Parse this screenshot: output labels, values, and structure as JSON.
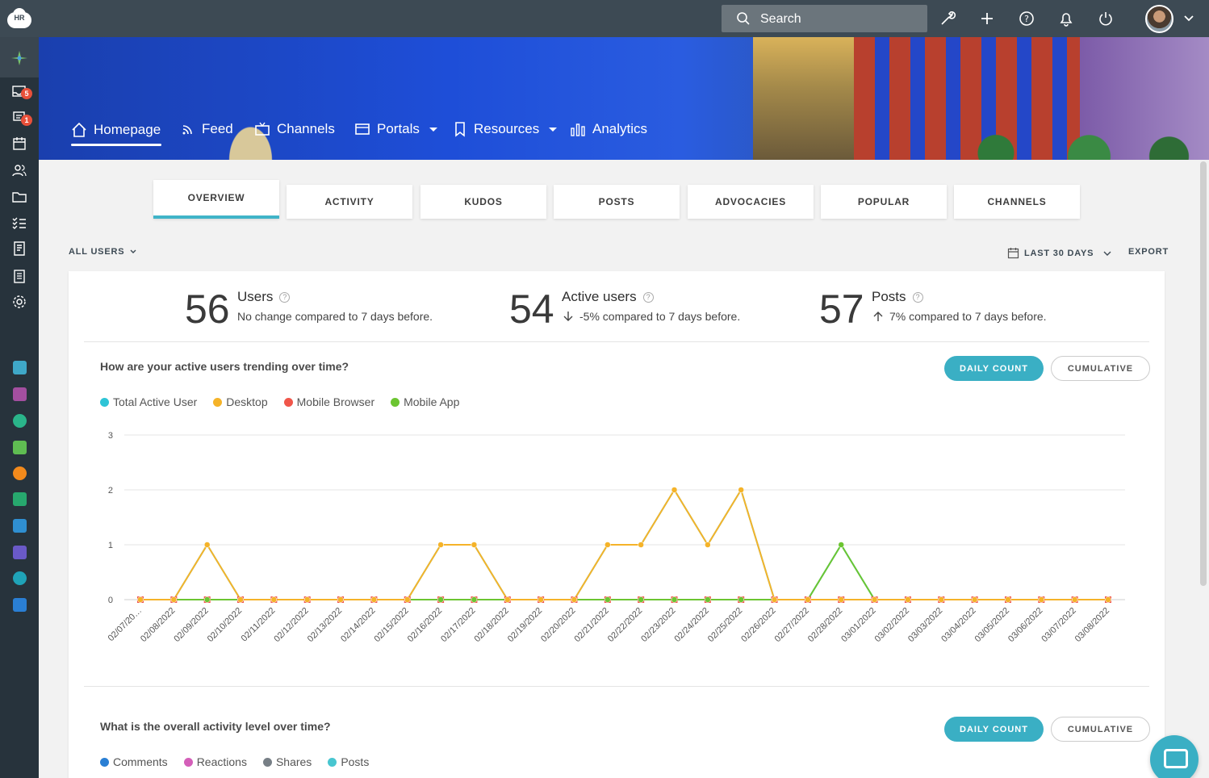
{
  "topbar": {
    "logo_text": "HR",
    "search_placeholder": "Search",
    "icons": [
      "wrench-icon",
      "plus-icon",
      "help-icon",
      "bell-icon",
      "power-icon"
    ]
  },
  "sidebar": {
    "badges": {
      "inbox": "5",
      "messages": "1"
    },
    "icons": [
      "hub-icon",
      "inbox-icon",
      "messages-icon",
      "calendar-icon",
      "people-icon",
      "folder-icon",
      "checklist-icon",
      "document-icon",
      "clipboard-icon",
      "settings-icon"
    ],
    "apps": [
      "app-1",
      "app-2",
      "app-3",
      "app-4",
      "app-5",
      "app-6",
      "app-7",
      "app-8",
      "app-9",
      "app-10"
    ]
  },
  "nav": {
    "items": [
      {
        "label": "Homepage",
        "icon": "home-icon"
      },
      {
        "label": "Feed",
        "icon": "feed-icon"
      },
      {
        "label": "Channels",
        "icon": "channels-icon"
      },
      {
        "label": "Portals",
        "icon": "portals-icon"
      },
      {
        "label": "Resources",
        "icon": "bookmark-icon"
      },
      {
        "label": "Analytics",
        "icon": "analytics-icon"
      }
    ]
  },
  "tabs": [
    "OVERVIEW",
    "ACTIVITY",
    "KUDOS",
    "POSTS",
    "ADVOCACIES",
    "POPULAR",
    "CHANNELS"
  ],
  "filters": {
    "users": "ALL USERS",
    "range": "LAST 30 DAYS",
    "export": "EXPORT"
  },
  "stats": [
    {
      "value": "56",
      "title": "Users",
      "sub": "No change compared to 7 days before.",
      "trend": ""
    },
    {
      "value": "54",
      "title": "Active users",
      "sub": "-5% compared to 7 days before.",
      "trend": "down"
    },
    {
      "value": "57",
      "title": "Posts",
      "sub": "7% compared to 7 days before.",
      "trend": "up"
    }
  ],
  "section1": {
    "title": "How are your active users trending over time?",
    "daily": "DAILY COUNT",
    "cumulative": "CUMULATIVE",
    "legend": [
      {
        "name": "Total Active User",
        "color": "#2ec4d6"
      },
      {
        "name": "Desktop",
        "color": "#f5b329"
      },
      {
        "name": "Mobile Browser",
        "color": "#f0564a"
      },
      {
        "name": "Mobile App",
        "color": "#6cc531"
      }
    ]
  },
  "section2": {
    "title": "What is the overall activity level over time?",
    "daily": "DAILY COUNT",
    "cumulative": "CUMULATIVE",
    "legend": [
      {
        "name": "Comments",
        "color": "#2a7fd4"
      },
      {
        "name": "Reactions",
        "color": "#d45fb9"
      },
      {
        "name": "Shares",
        "color": "#777f86"
      },
      {
        "name": "Posts",
        "color": "#48c6d0"
      }
    ]
  },
  "chart_data": {
    "type": "line",
    "title": "How are your active users trending over time?",
    "x": [
      "02/07/20…",
      "02/08/2022",
      "02/09/2022",
      "02/10/2022",
      "02/11/2022",
      "02/12/2022",
      "02/13/2022",
      "02/14/2022",
      "02/15/2022",
      "02/16/2022",
      "02/17/2022",
      "02/18/2022",
      "02/19/2022",
      "02/20/2022",
      "02/21/2022",
      "02/22/2022",
      "02/23/2022",
      "02/24/2022",
      "02/25/2022",
      "02/26/2022",
      "02/27/2022",
      "02/28/2022",
      "03/01/2022",
      "03/02/2022",
      "03/03/2022",
      "03/04/2022",
      "03/05/2022",
      "03/06/2022",
      "03/07/2022",
      "03/08/2022"
    ],
    "ylim": [
      0,
      3
    ],
    "yticks": [
      0,
      1,
      2,
      3
    ],
    "grid": true,
    "series": [
      {
        "name": "Total Active User",
        "color": "#2ec4d6",
        "values": [
          0,
          0,
          1,
          0,
          0,
          0,
          0,
          0,
          0,
          1,
          1,
          0,
          0,
          0,
          1,
          1,
          2,
          1,
          2,
          0,
          0,
          1,
          0,
          0,
          0,
          0,
          0,
          0,
          0,
          0
        ]
      },
      {
        "name": "Desktop",
        "color": "#f5b329",
        "values": [
          0,
          0,
          1,
          0,
          0,
          0,
          0,
          0,
          0,
          1,
          1,
          0,
          0,
          0,
          1,
          1,
          2,
          1,
          2,
          0,
          0,
          0,
          0,
          0,
          0,
          0,
          0,
          0,
          0,
          0
        ]
      },
      {
        "name": "Mobile Browser",
        "color": "#f0564a",
        "values": [
          0,
          0,
          0,
          0,
          0,
          0,
          0,
          0,
          0,
          0,
          0,
          0,
          0,
          0,
          0,
          0,
          0,
          0,
          0,
          0,
          0,
          0,
          0,
          0,
          0,
          0,
          0,
          0,
          0,
          0
        ]
      },
      {
        "name": "Mobile App",
        "color": "#6cc531",
        "values": [
          0,
          0,
          0,
          0,
          0,
          0,
          0,
          0,
          0,
          0,
          0,
          0,
          0,
          0,
          0,
          0,
          0,
          0,
          0,
          0,
          0,
          1,
          0,
          0,
          0,
          0,
          0,
          0,
          0,
          0
        ]
      }
    ]
  }
}
